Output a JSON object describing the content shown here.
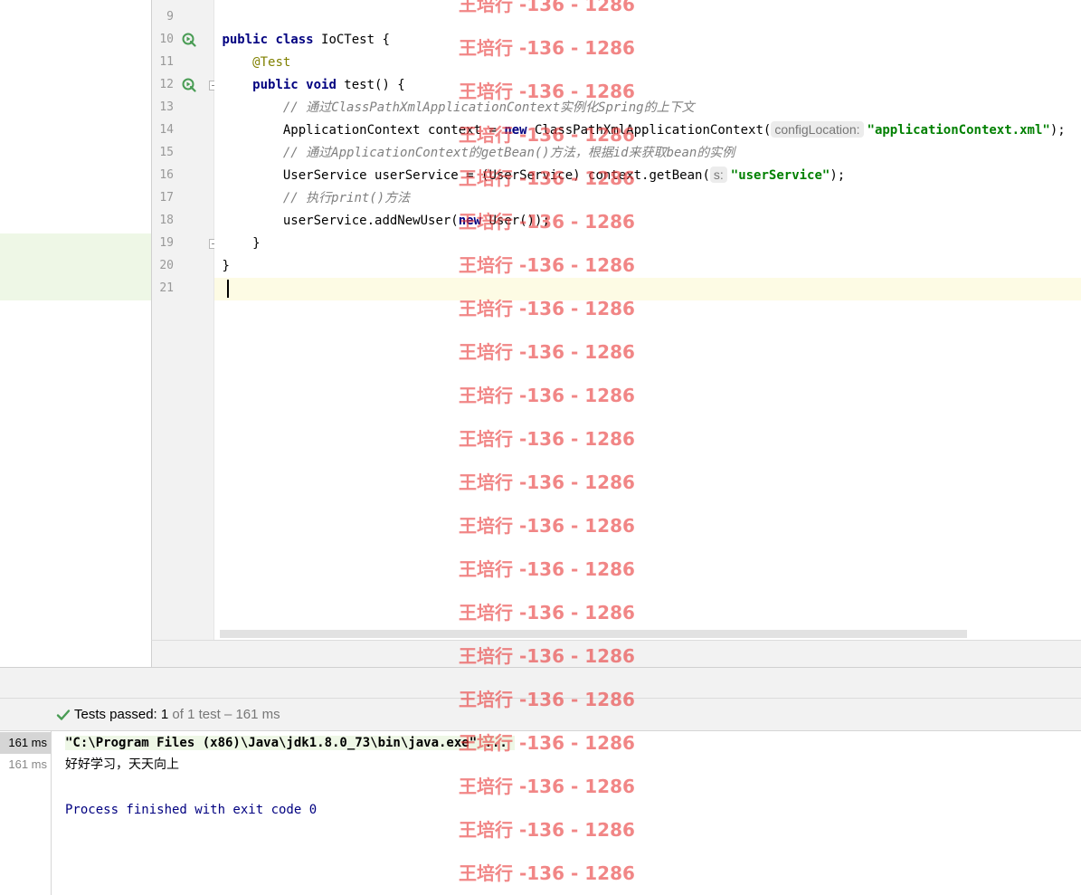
{
  "editor": {
    "lines": [
      {
        "num": "9",
        "run": false,
        "fold": false,
        "tokens": []
      },
      {
        "num": "10",
        "run": true,
        "fold": false,
        "tokens": [
          {
            "t": "public class",
            "c": "kw"
          },
          {
            "t": " IoCTest {",
            "c": ""
          }
        ]
      },
      {
        "num": "11",
        "run": false,
        "fold": false,
        "tokens": [
          {
            "t": "    ",
            "c": ""
          },
          {
            "t": "@Test",
            "c": "ann"
          }
        ]
      },
      {
        "num": "12",
        "run": true,
        "fold": true,
        "tokens": [
          {
            "t": "    ",
            "c": ""
          },
          {
            "t": "public void",
            "c": "kw"
          },
          {
            "t": " test() {",
            "c": ""
          }
        ]
      },
      {
        "num": "13",
        "run": false,
        "fold": false,
        "tokens": [
          {
            "t": "        ",
            "c": ""
          },
          {
            "t": "// 通过ClassPathXmlApplicationContext实例化Spring的上下文",
            "c": "cmt"
          }
        ]
      },
      {
        "num": "14",
        "run": false,
        "fold": false,
        "tokens": [
          {
            "t": "        ApplicationContext context = ",
            "c": ""
          },
          {
            "t": "new",
            "c": "kw"
          },
          {
            "t": " ClassPathXmlApplicationContext(",
            "c": ""
          },
          {
            "t": "configLocation:",
            "c": "hint"
          },
          {
            "t": "\"applicationContext.xml\"",
            "c": "str"
          },
          {
            "t": ");",
            "c": ""
          }
        ]
      },
      {
        "num": "15",
        "run": false,
        "fold": false,
        "tokens": [
          {
            "t": "        ",
            "c": ""
          },
          {
            "t": "// 通过ApplicationContext的getBean()方法，根据id来获取bean的实例",
            "c": "cmt"
          }
        ]
      },
      {
        "num": "16",
        "run": false,
        "fold": false,
        "tokens": [
          {
            "t": "        UserService userService = (UserService) context.getBean(",
            "c": ""
          },
          {
            "t": "s:",
            "c": "hint"
          },
          {
            "t": "\"userService\"",
            "c": "str"
          },
          {
            "t": ");",
            "c": ""
          }
        ]
      },
      {
        "num": "17",
        "run": false,
        "fold": false,
        "tokens": [
          {
            "t": "        ",
            "c": ""
          },
          {
            "t": "// 执行print()方法",
            "c": "cmt"
          }
        ]
      },
      {
        "num": "18",
        "run": false,
        "fold": false,
        "tokens": [
          {
            "t": "        userService.addNewUser(",
            "c": ""
          },
          {
            "t": "new",
            "c": "kw"
          },
          {
            "t": " User());",
            "c": ""
          }
        ]
      },
      {
        "num": "19",
        "run": false,
        "fold": true,
        "tokens": [
          {
            "t": "    }",
            "c": ""
          }
        ]
      },
      {
        "num": "20",
        "run": false,
        "fold": false,
        "tokens": [
          {
            "t": "}",
            "c": ""
          }
        ]
      },
      {
        "num": "21",
        "run": false,
        "fold": false,
        "tokens": [],
        "current": true
      }
    ]
  },
  "tests": {
    "status_label": "Tests passed:",
    "passed": "1",
    "summary": "of 1 test – 161 ms"
  },
  "tree": {
    "rows": [
      {
        "label": "161 ms",
        "selected": true
      },
      {
        "label": "161 ms",
        "selected": false
      }
    ]
  },
  "console": {
    "command": "\"C:\\Program Files (x86)\\Java\\jdk1.8.0_73\\bin\\java.exe\" ...",
    "output": "好好学习，天天向上",
    "exit": "Process finished with exit code 0"
  },
  "watermark": {
    "text": "王培行 -136 - 1286",
    "repeat": 21
  },
  "colors": {
    "keyword": "#000080",
    "annotation": "#808000",
    "comment": "#808080",
    "string": "#008000",
    "run_icon": "#499c54",
    "check_icon": "#499c54",
    "watermark": "#e83c3c"
  },
  "icons": {
    "run": "run-test-icon",
    "fold": "fold-marker-icon",
    "check": "check-icon"
  }
}
